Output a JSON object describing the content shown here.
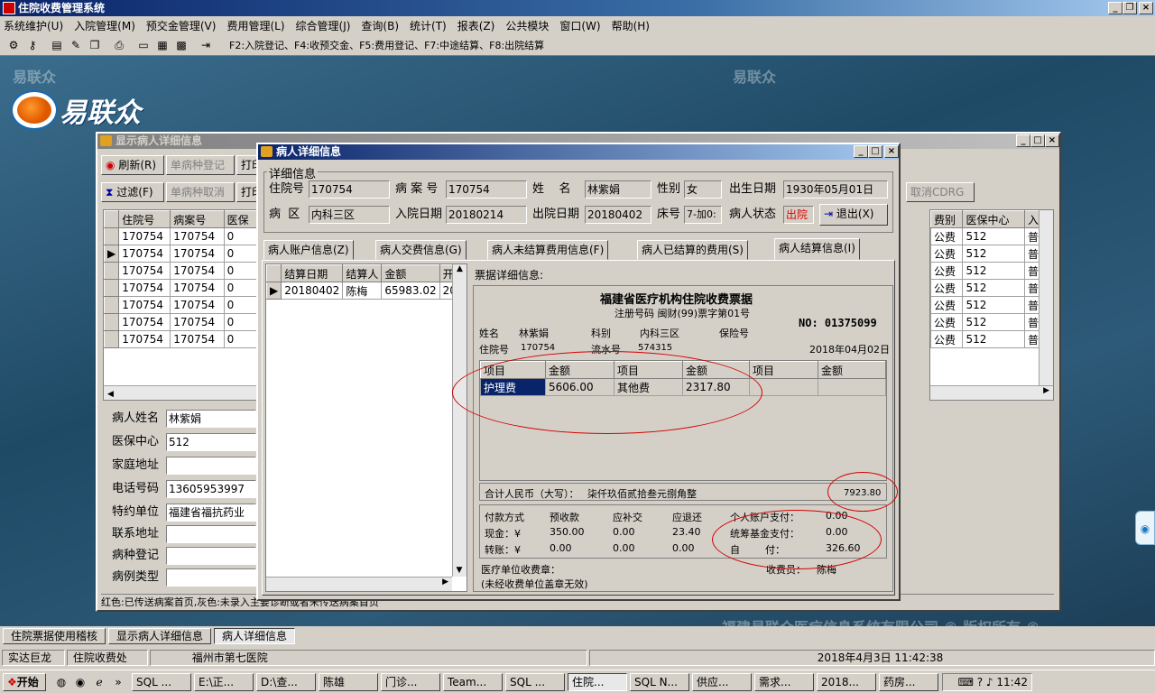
{
  "app": {
    "title": "住院收费管理系统"
  },
  "menu": [
    "系统维护(U)",
    "入院管理(M)",
    "预交金管理(V)",
    "费用管理(L)",
    "综合管理(J)",
    "查询(B)",
    "统计(T)",
    "报表(Z)",
    "公共模块",
    "窗口(W)",
    "帮助(H)"
  ],
  "toolbar": {
    "hint": "F2:入院登记、F4:收预交金、F5:费用登记、F7:中途结算、F8:出院结算"
  },
  "brand": {
    "logo": "易联众",
    "logo_ghost": "易联众",
    "footer": "福建易联众医疗信息系统有限公司 © 版权所有 ©"
  },
  "back_win": {
    "title": "显示病人详细信息",
    "refresh": "刷新(R)",
    "single_reg": "单病种登记",
    "print": "打印",
    "filter": "过滤(F)",
    "single_cancel": "单病种取消",
    "print2": "打印",
    "cancel_cdrg": "取消CDRG",
    "left_headers": [
      "住院号",
      "病案号",
      "医保"
    ],
    "right_headers": [
      "费别",
      "医保中心",
      "入科"
    ],
    "rows": [
      [
        "170754",
        "170754",
        "0",
        "公费",
        "512",
        "普通"
      ],
      [
        "170754",
        "170754",
        "0",
        "公费",
        "512",
        "普通"
      ],
      [
        "170754",
        "170754",
        "0",
        "公费",
        "512",
        "普通"
      ],
      [
        "170754",
        "170754",
        "0",
        "公费",
        "512",
        "普通"
      ],
      [
        "170754",
        "170754",
        "0",
        "公费",
        "512",
        "普通"
      ],
      [
        "170754",
        "170754",
        "0",
        "公费",
        "512",
        "普通"
      ],
      [
        "170754",
        "170754",
        "0",
        "公费",
        "512",
        "普通"
      ]
    ],
    "form": {
      "name_lbl": "病人姓名",
      "name": "林紫娟",
      "center_lbl": "医保中心",
      "center": "512",
      "addr_lbl": "家庭地址",
      "addr": "",
      "phone_lbl": "电话号码",
      "phone": "13605953997",
      "unit_lbl": "特约单位",
      "unit": "福建省福抗药业",
      "contact_lbl": "联系地址",
      "contact": "",
      "disease_lbl": "病种登记",
      "disease": "",
      "case_lbl": "病例类型",
      "case": ""
    },
    "legend": "红色:已传送病案首页,灰色:未录入主要诊断或者未传送病案首页"
  },
  "detail_win": {
    "title": "病人详细信息",
    "group": "详细信息",
    "zyh_lbl": "住院号",
    "zyh": "170754",
    "bah_lbl": "病 案 号",
    "bah": "170754",
    "name_lbl": "姓    名",
    "name": "林紫娟",
    "sex_lbl": "性别",
    "sex": "女",
    "birth_lbl": "出生日期",
    "birth": "1930年05月01日",
    "ward_lbl": "病  区",
    "ward": "内科三区",
    "in_lbl": "入院日期",
    "in": "20180214",
    "out_lbl": "出院日期",
    "out": "20180402",
    "bed_lbl": "床号",
    "bed": "7-加0:",
    "state_lbl": "病人状态",
    "state": "出院",
    "exit": "退出(X)",
    "tabs": [
      "病人账户信息(Z)",
      "病人交费信息(G)",
      "病人未结算费用信息(F)",
      "病人已结算的费用(S)",
      "病人结算信息(I)"
    ],
    "settle_headers": [
      "结算日期",
      "结算人",
      "金额",
      "开"
    ],
    "settle_rows": [
      [
        "20180402",
        "陈梅",
        "65983.02",
        "20"
      ]
    ],
    "receipt_lbl": "票据详细信息:"
  },
  "receipt": {
    "title": "福建省医疗机构住院收费票据",
    "reg": "注册号码 闽财(99)票字第01号",
    "no": "NO: 01375099",
    "name_lbl": "姓名",
    "name": "林紫娟",
    "dept_lbl": "科别",
    "dept": "内科三区",
    "ins_lbl": "保险号",
    "zyh_lbl": "住院号",
    "zyh": "170754",
    "serial_lbl": "流水号",
    "serial": "574315",
    "date": "2018年04月02日",
    "headers": [
      "项目",
      "金额",
      "项目",
      "金额",
      "项目",
      "金额"
    ],
    "items": [
      [
        "护理费",
        "5606.00",
        "其他费",
        "2317.80",
        "",
        ""
      ]
    ],
    "total_lbl": "合计人民币（大写）：",
    "total_cn": "柒仟玖佰贰拾叁元捌角整",
    "total": "7923.80",
    "pay_method": "付款方式",
    "prepay": "预收款",
    "supp": "应补交",
    "refund": "应退还",
    "cash_lbl": "现金：¥",
    "cash": [
      "350.00",
      "0.00",
      "23.40"
    ],
    "transfer_lbl": "转账：¥",
    "transfer": [
      "0.00",
      "0.00",
      "0.00"
    ],
    "personal_lbl": "个人账户支付：",
    "personal": "0.00",
    "fund_lbl": "统筹基金支付：",
    "fund": "0.00",
    "self_lbl": "自        付：",
    "self": "326.60",
    "seal": "医疗单位收费章：",
    "seal_note": "(未经收费单位盖章无效)",
    "cashier_lbl": "收费员：",
    "cashier": "陈梅"
  },
  "window_tabs": [
    "住院票据使用稽核",
    "显示病人详细信息",
    "病人详细信息"
  ],
  "status": {
    "company": "实达巨龙",
    "dept": "住院收费处",
    "hospital": "福州市第七医院",
    "datetime": "2018年4月3日 11:42:38"
  },
  "taskbar": {
    "start": "开始",
    "items": [
      "SQL ...",
      "E:\\正...",
      "D:\\查...",
      "陈雄",
      "门诊...",
      "Team...",
      "SQL ...",
      "住院...",
      "SQL N...",
      "供应...",
      "需求...",
      "2018...",
      "药房..."
    ],
    "clock": "11:42"
  }
}
